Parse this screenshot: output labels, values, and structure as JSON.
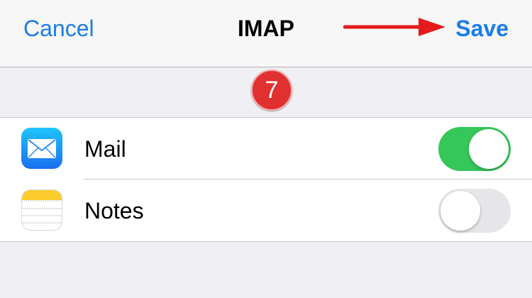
{
  "navbar": {
    "cancel_label": "Cancel",
    "title": "IMAP",
    "save_label": "Save"
  },
  "annotation": {
    "step_number": "7",
    "badge_color": "#e03030",
    "arrow_color": "#e51a1a"
  },
  "list": {
    "items": [
      {
        "label": "Mail",
        "icon": "mail-app-icon",
        "enabled": true
      },
      {
        "label": "Notes",
        "icon": "notes-app-icon",
        "enabled": false
      }
    ]
  },
  "colors": {
    "accent": "#1a7ee6",
    "toggle_on": "#35c759",
    "toggle_off": "#e6e6e9",
    "background": "#efeff4"
  }
}
